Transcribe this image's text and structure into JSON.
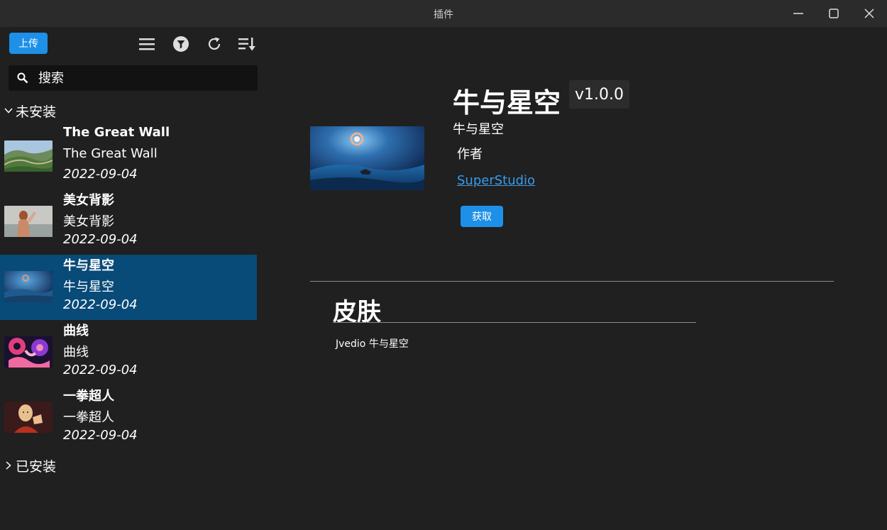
{
  "window": {
    "title": "插件"
  },
  "toolbar": {
    "upload_label": "上传"
  },
  "search": {
    "placeholder": "搜索"
  },
  "groups": {
    "uninstalled_label": "未安装",
    "installed_label": "已安装"
  },
  "plugins": [
    {
      "name": "The Great Wall",
      "description": "The Great Wall",
      "date": "2022-09-04"
    },
    {
      "name": "美女背影",
      "description": "美女背影",
      "date": "2022-09-04"
    },
    {
      "name": "牛与星空",
      "description": "牛与星空",
      "date": "2022-09-04"
    },
    {
      "name": "曲线",
      "description": "曲线",
      "date": "2022-09-04"
    },
    {
      "name": "一拳超人",
      "description": "一拳超人",
      "date": "2022-09-04"
    }
  ],
  "detail": {
    "title": "牛与星空",
    "version": "v1.0.0",
    "subtitle": "牛与星空",
    "author_label": "作者",
    "author_name": "SuperStudio",
    "get_label": "获取",
    "section_title": "皮肤",
    "section_text": "Jvedio 牛与星空"
  },
  "colors": {
    "accent": "#1e90e8",
    "selected": "#084a78",
    "background": "#202020"
  }
}
